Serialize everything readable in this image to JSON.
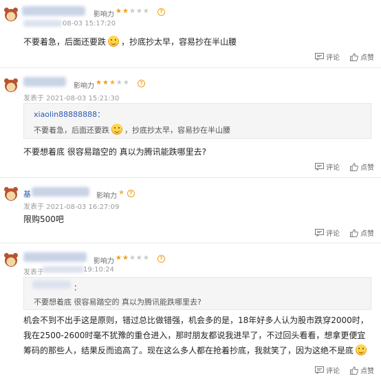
{
  "posts": [
    {
      "influence_label": "影响力",
      "time": "08-03 15:17:20",
      "content_a": "不要着急，后面还要跌",
      "content_b": "，抄底抄太早，容易抄在半山腰",
      "rating": 2,
      "comment_label": "评论",
      "like_label": "点赞"
    },
    {
      "influence_label": "影响力",
      "time": "发表于 2021-08-03 15:21:30",
      "quote_user": "xiaolin88888888：",
      "quote_text_a": "不要着急，后面还要跌",
      "quote_text_b": "，抄底抄太早，容易抄在半山腰",
      "content": "不要想着底 很容易踏空的 真以为腾讯能跌哪里去?",
      "rating": 2.5,
      "comment_label": "评论",
      "like_label": "点赞"
    },
    {
      "influence_label": "影响力",
      "user_fragment": "基",
      "time": "发表于 2021-08-03 16:27:09",
      "content": "限购500吧",
      "rating": 0.5,
      "comment_label": "评论",
      "like_label": "点赞"
    },
    {
      "influence_label": "影响力",
      "time": "发表于",
      "time_tail": "19:10:24",
      "quote_colon": "：",
      "quote_text": "不要想着底 很容易踏空的 真以为腾讯能跌哪里去?",
      "content_a": "机会不到不出手这是原则，错过总比做错强，机会多的是，18年好多人认为股市跌穿2000时，我在2500-2600时毫不犹豫的重仓进入，那时朋友都说我进早了，不过回头看看，想拿更便宜筹码的那些人，结果反而追高了。现在这么多人都在抢着抄底，我就笑了，因为这绝不是底",
      "rating": 2,
      "comment_label": "评论",
      "like_label": "点赞"
    }
  ],
  "colors": {
    "star": "#f39c12",
    "link": "#2b58b0",
    "quote_bg": "#f5f5f5"
  },
  "icons": {
    "comment": "comment-icon",
    "like": "thumbs-up-icon",
    "help": "question-icon",
    "emoji": "smile-emoji-icon"
  }
}
